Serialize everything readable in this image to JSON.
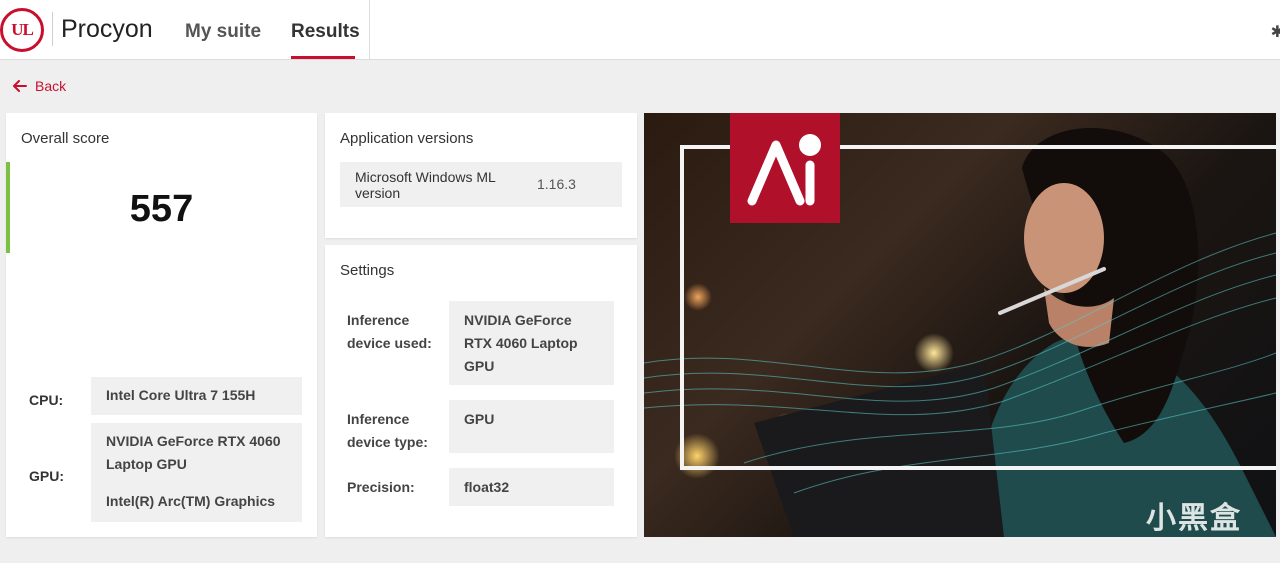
{
  "header": {
    "logo_text": "UL",
    "app_name": "Procyon",
    "tabs": [
      {
        "label": "My suite",
        "active": false
      },
      {
        "label": "Results",
        "active": true
      }
    ]
  },
  "back_label": "Back",
  "overall": {
    "title": "Overall score",
    "score": "557",
    "cpu_label": "CPU:",
    "cpu_value": "Intel Core Ultra 7 155H",
    "gpu_label": "GPU:",
    "gpu_values": [
      "NVIDIA GeForce RTX 4060 Laptop GPU",
      "Intel(R) Arc(TM) Graphics"
    ]
  },
  "versions": {
    "title": "Application versions",
    "rows": [
      {
        "name": "Microsoft Windows ML version",
        "value": "1.16.3"
      }
    ]
  },
  "settings": {
    "title": "Settings",
    "rows": [
      {
        "label": "Inference device used:",
        "value": "NVIDIA GeForce RTX 4060 Laptop GPU"
      },
      {
        "label": "Inference device type:",
        "value": "GPU"
      },
      {
        "label": "Precision:",
        "value": "float32"
      }
    ]
  },
  "hero": {
    "watermark": "小黑盒"
  },
  "colors": {
    "brand_red": "#c8102e",
    "score_accent": "#7ac143",
    "panel_gray": "#f0f0f0"
  }
}
